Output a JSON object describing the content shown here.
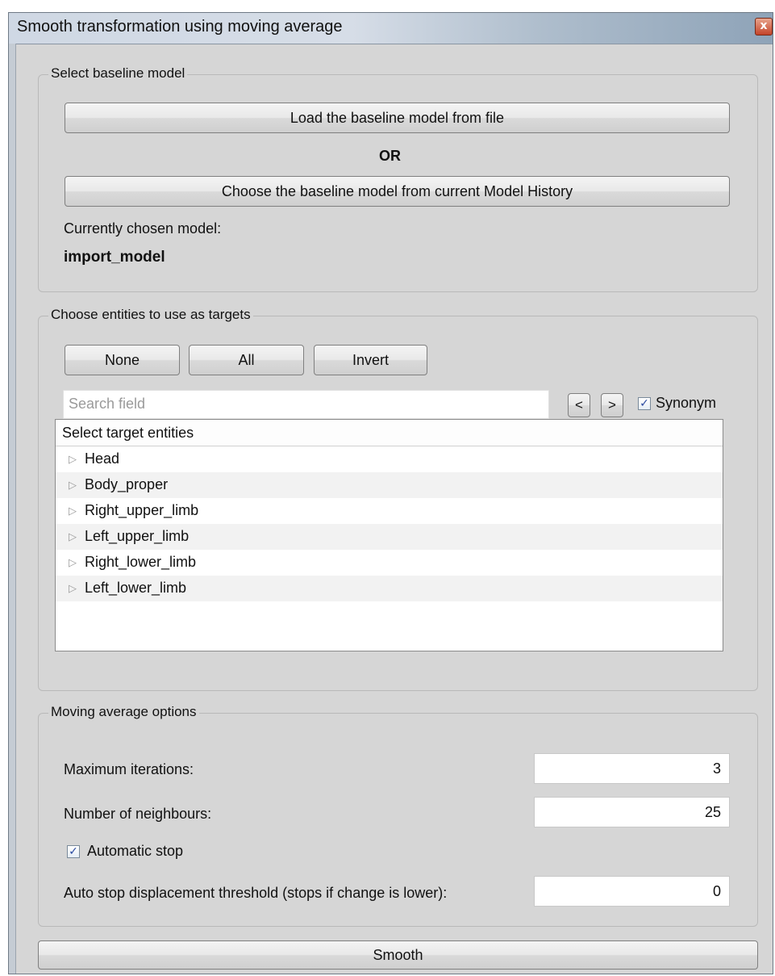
{
  "window": {
    "title": "Smooth transformation using moving average",
    "close_glyph": "x"
  },
  "baseline": {
    "group_title": "Select baseline model",
    "load_button": "Load the baseline model from file",
    "or_label": "OR",
    "choose_button": "Choose the baseline model from current Model History",
    "chosen_label": "Currently chosen model:",
    "chosen_value": "import_model"
  },
  "targets": {
    "group_title": "Choose entities to use as targets",
    "none_button": "None",
    "all_button": "All",
    "invert_button": "Invert",
    "search_placeholder": "Search field",
    "prev_button": "<",
    "next_button": ">",
    "synonym_label": "Synonym",
    "synonym_checked": true,
    "tree_header": "Select target entities",
    "entities": [
      "Head",
      "Body_proper",
      "Right_upper_limb",
      "Left_upper_limb",
      "Right_lower_limb",
      "Left_lower_limb"
    ]
  },
  "options": {
    "group_title": "Moving average options",
    "max_iter_label": "Maximum iterations:",
    "max_iter_value": "3",
    "neighbours_label": "Number of neighbours:",
    "neighbours_value": "25",
    "auto_stop_label": "Automatic stop",
    "auto_stop_checked": true,
    "threshold_label": "Auto stop displacement threshold (stops if change is lower):",
    "threshold_value": "0"
  },
  "smooth_button": "Smooth"
}
